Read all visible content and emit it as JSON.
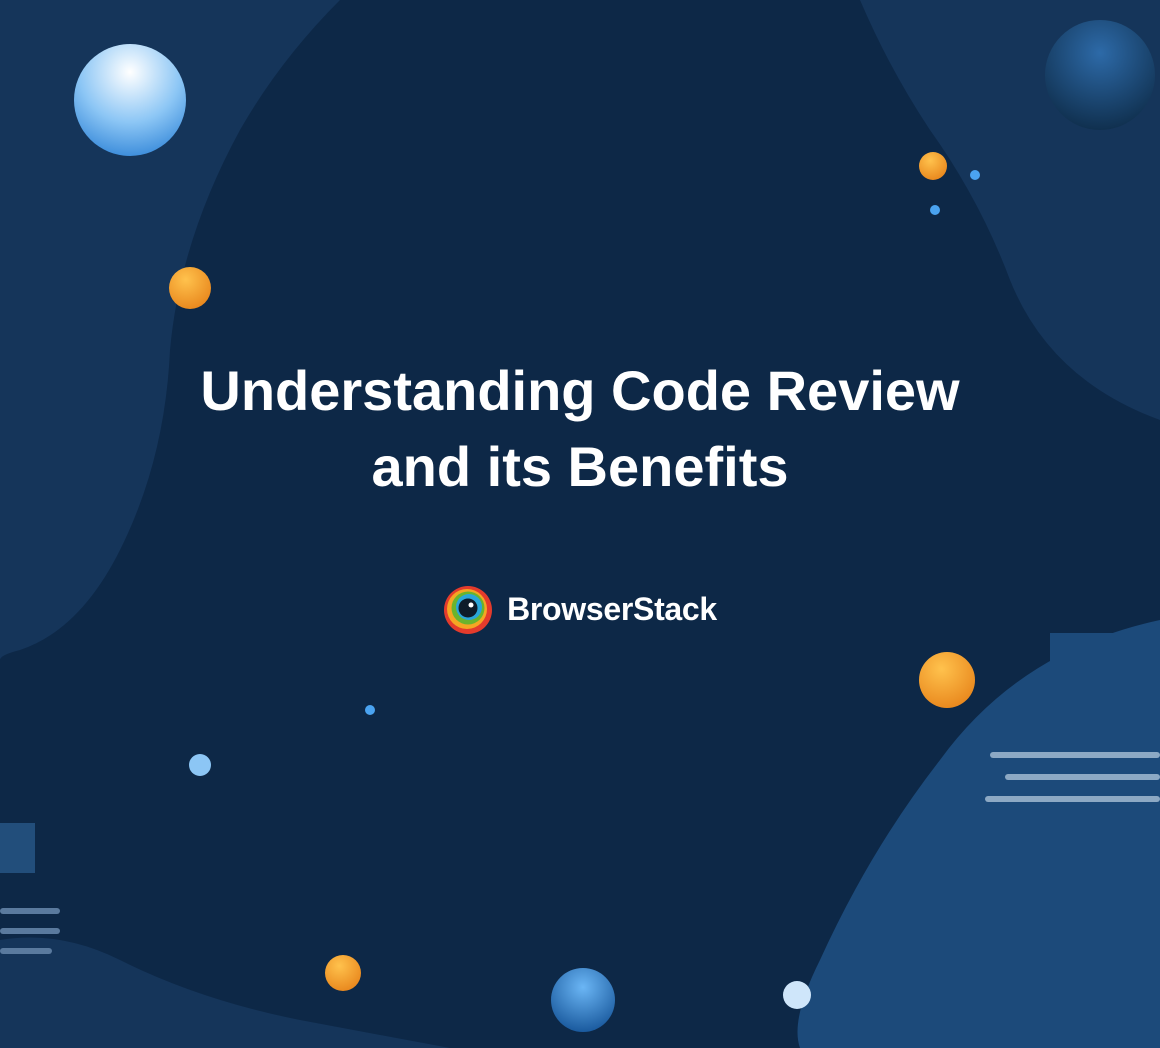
{
  "title": "Understanding Code Review and its Benefits",
  "brand": {
    "name": "BrowserStack"
  },
  "colors": {
    "bg_dark": "#0d2847",
    "bg_mid": "#15355a",
    "bg_light": "#1c4a7a",
    "orange": "#f5a623",
    "orange_dark": "#e8861c",
    "blue_light": "#3f8fdc",
    "blue_bright": "#4aa3f0",
    "white": "#ffffff"
  }
}
